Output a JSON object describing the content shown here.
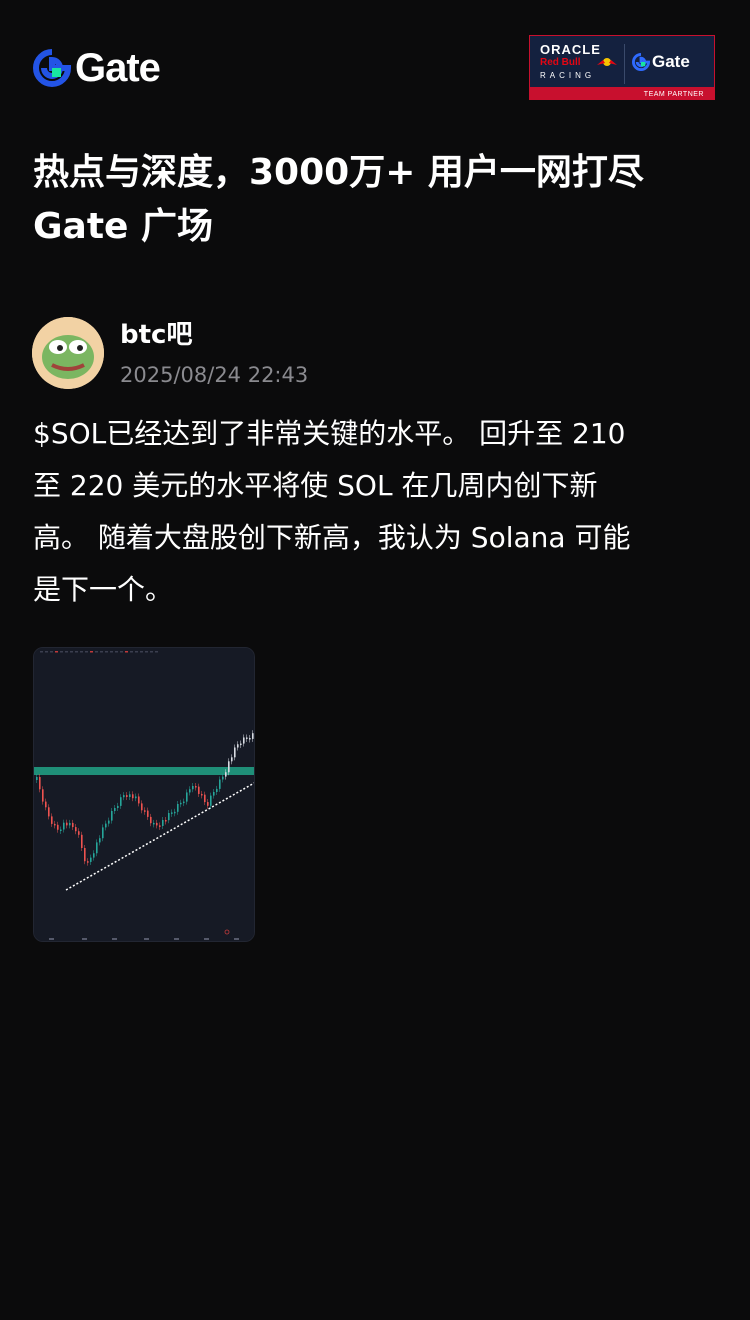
{
  "header": {
    "brand_name": "Gate",
    "partner": {
      "oracle": "ORACLE",
      "redbull": "Red Bull",
      "racing": "RACING",
      "gate": "Gate",
      "team_partner": "TEAM PARTNER",
      "colors": {
        "navy": "#14213f",
        "red": "#c8102e"
      }
    }
  },
  "headline": {
    "line1": "热点与深度，3000万+ 用户一网打尽",
    "line2": "Gate 广场"
  },
  "post": {
    "author": "btc吧",
    "timestamp": "2025/08/24 22:43",
    "text_lines": [
      "$SOL已经达到了非常关键的水平。 回升至 210",
      "至 220 美元的水平将使 SOL 在几周内创下新",
      "高。 随着大盘股创下新高，我认为 Solana 可能",
      "是下一个。"
    ],
    "image": {
      "kind": "candlestick-chart-thumbnail",
      "accent": "#1f8f78"
    }
  },
  "colors": {
    "background": "#0b0b0c",
    "text": "#ffffff",
    "muted": "#8a8a8f",
    "brand_blue": "#2354e6",
    "brand_green": "#17e6a1"
  },
  "icons": [
    "gate-logo-icon",
    "author-avatar"
  ]
}
